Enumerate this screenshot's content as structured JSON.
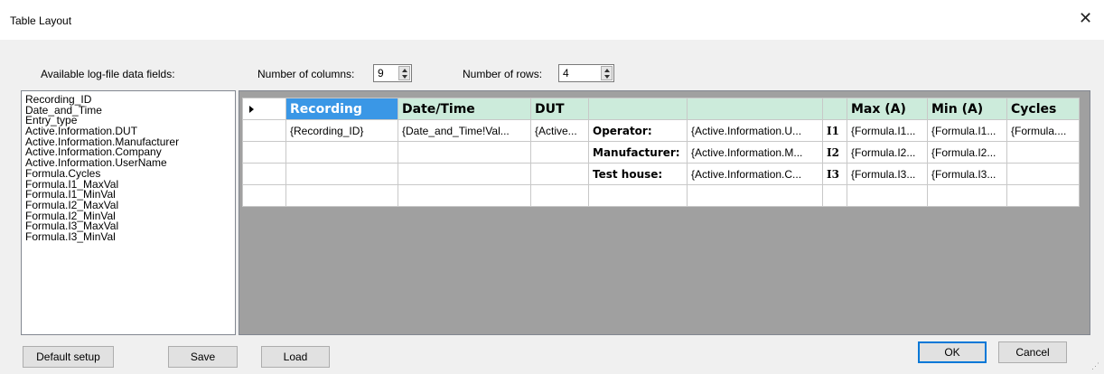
{
  "window": {
    "title": "Table Layout"
  },
  "fields_label": "Available log-file data fields:",
  "columns": {
    "label": "Number of columns:",
    "value": "9"
  },
  "rows": {
    "label": "Number of rows:",
    "value": "4"
  },
  "fields": [
    "Recording_ID",
    "Date_and_Time",
    "Entry_type",
    "Active.Information.DUT",
    "Active.Information.Manufacturer",
    "Active.Information.Company",
    "Active.Information.UserName",
    "Formula.Cycles",
    "Formula.I1_MaxVal",
    "Formula.I1_MinVal",
    "Formula.I2_MaxVal",
    "Formula.I2_MinVal",
    "Formula.I3_MaxVal",
    "Formula.I3_MinVal"
  ],
  "grid": {
    "header": [
      "Recording",
      "Date/Time",
      "DUT",
      "",
      "",
      "",
      "Max (A)",
      "Min (A)",
      "Cycles"
    ],
    "rows": [
      [
        "{Recording_ID}",
        "{Date_and_Time!Val...",
        "{Active...",
        "Operator:",
        "{Active.Information.U...",
        "I1",
        "{Formula.I1...",
        "{Formula.I1...",
        "{Formula...."
      ],
      [
        "",
        "",
        "",
        "Manufacturer:",
        "{Active.Information.M...",
        "I2",
        "{Formula.I2...",
        "{Formula.I2...",
        ""
      ],
      [
        "",
        "",
        "",
        "Test house:",
        "{Active.Information.C...",
        "I3",
        "{Formula.I3...",
        "{Formula.I3...",
        ""
      ],
      [
        "",
        "",
        "",
        "",
        "",
        "",
        "",
        "",
        ""
      ]
    ]
  },
  "buttons": {
    "default_setup": "Default setup",
    "save": "Save",
    "load": "Load",
    "ok": "OK",
    "cancel": "Cancel"
  },
  "icons": {
    "close": "close-icon",
    "row_indicator": "row-pointer-icon"
  }
}
